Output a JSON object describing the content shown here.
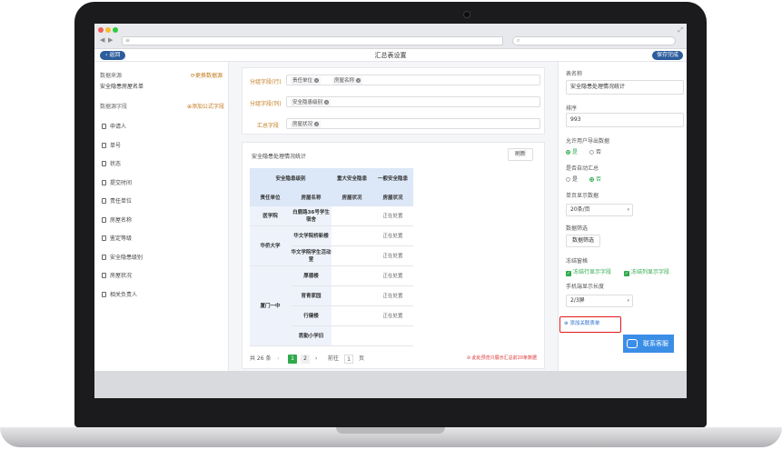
{
  "browser": {
    "url": "≡",
    "nav_back": "◀",
    "nav_fwd": "▶"
  },
  "header": {
    "back_label": "返回",
    "title": "汇总表设置",
    "save_label": "保存完成"
  },
  "left": {
    "source_label": "数据来源",
    "switch_link": "⟳更换数据源",
    "source_value": "安全隐患房屋名单",
    "fields_label": "数据源字段",
    "add_formula_link": "⊕添加公式字段",
    "fields": [
      "申请人",
      "单号",
      "状态",
      "提交时间",
      "责任单位",
      "房屋名称",
      "鉴定等级",
      "安全隐患级别",
      "房屋状况",
      "相关负责人"
    ]
  },
  "config": {
    "row_group_label": "分组字段(行)",
    "row_tags": [
      "责任单位",
      "房屋名称"
    ],
    "col_group_label": "分组字段(列)",
    "col_tags": [
      "安全隐患级别"
    ],
    "summary_label": "汇总字段",
    "summary_tags": [
      "房屋状况"
    ]
  },
  "preview": {
    "title": "安全隐患处理情况统计",
    "refresh_label": "刷新",
    "header_row1": [
      "安全隐患级别",
      "重大安全隐患",
      "一般安全隐患"
    ],
    "header_row2": [
      "责任单位",
      "房屋名称",
      "房屋状况",
      "房屋状况"
    ],
    "groups": [
      {
        "unit": "医学院",
        "rows": [
          {
            "name": "白鹿路36号学生宿舍",
            "major": "",
            "normal": "正在处置"
          }
        ]
      },
      {
        "unit": "华侨大学",
        "rows": [
          {
            "name": "华文学院桥新楼",
            "major": "",
            "normal": "正在处置"
          },
          {
            "name": "华文学院学生活动室",
            "major": "",
            "normal": "正在处置"
          }
        ]
      },
      {
        "unit": "厦门一中",
        "rows": [
          {
            "name": "厚德楼",
            "major": "",
            "normal": "正在处置"
          },
          {
            "name": "育青家园",
            "major": "",
            "normal": "正在处置"
          },
          {
            "name": "行健楼",
            "major": "",
            "normal": "正在处置"
          },
          {
            "name": "思勤小学旧",
            "major": "",
            "normal": ""
          }
        ]
      }
    ],
    "pager": {
      "total": "共 26 条",
      "prev": "‹",
      "pages": [
        "1",
        "2"
      ],
      "next": "›",
      "goto_label": "前往",
      "goto_value": "1",
      "page_suffix": "页"
    },
    "warning": "⊘ 此处预览只展示汇总前20条数据"
  },
  "settings": {
    "table_name_label": "表名称",
    "table_name_value": "安全隐患处理情况统计",
    "order_label": "排序",
    "order_value": "993",
    "allow_export_label": "允许用户导出数据",
    "allow_export_yes": "是",
    "allow_export_no": "否",
    "auto_summary_label": "是否自动汇总",
    "auto_summary_no": "是",
    "auto_summary_yes": "否",
    "per_page_label": "单页显示数据",
    "per_page_value": "20条/页",
    "filter_label": "数据筛选",
    "filter_button": "数据筛选",
    "freeze_label": "冻结窗格",
    "freeze_row": "冻结行显示字段",
    "freeze_col": "冻结列显示字段",
    "mobile_width_label": "手机端显示长度",
    "mobile_width_value": "2/3屏",
    "add_related_link": "⊕ 添加关联表单",
    "service_label": "联系客服"
  }
}
